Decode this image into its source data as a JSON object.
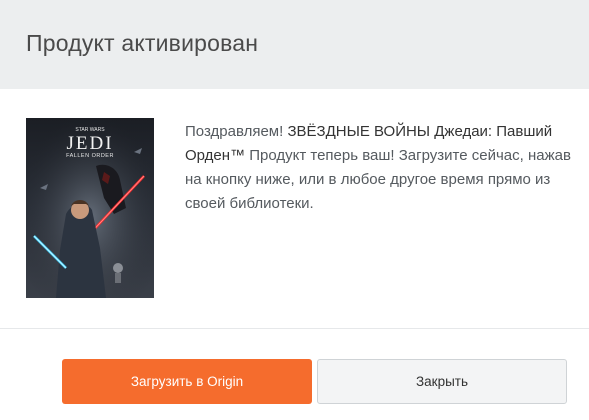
{
  "dialog": {
    "title": "Продукт активирован",
    "cover_logo_top": "STAR WARS",
    "cover_logo_main": "JEDI",
    "cover_logo_sub": "FALLEN ORDER",
    "message_intro": "Поздравляем! ",
    "message_product": "ЗВЁЗДНЫЕ ВОЙНЫ Джедаи: Павший Орден™",
    "message_rest": " Продукт теперь ваш! Загрузите сейчас, нажав на кнопку ниже, или в любое другое время прямо из своей библиотеки.",
    "download_button": "Загрузить в Origin",
    "close_button": "Закрыть"
  },
  "colors": {
    "header_bg": "#eceeef",
    "primary": "#f56c2d",
    "secondary_bg": "#f3f4f5"
  }
}
